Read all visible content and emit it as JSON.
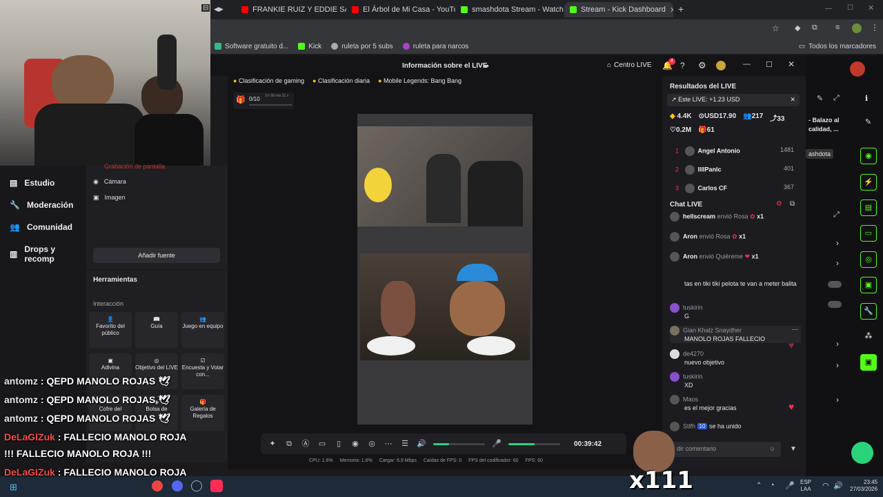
{
  "browser": {
    "tabs": [
      {
        "label": "FRANKIE RUIZ Y EDDIE SANTIA",
        "color": "#ff0000"
      },
      {
        "label": "El Árbol de Mi Casa - YouTube",
        "color": "#ff0000"
      },
      {
        "label": "smashdota Stream - Watch Live",
        "color": "#53fc18"
      },
      {
        "label": "Stream - Kick Dashboard",
        "color": "#53fc18"
      }
    ],
    "new_tab": "+",
    "bookmarks": [
      "Software gratuito d...",
      "Kick",
      "ruleta por 5 subs",
      "ruleta para narcos"
    ],
    "bookmarks_right": "Todos los marcadores"
  },
  "left_nav": {
    "items": [
      {
        "label": "Estudio",
        "icon": "studio-icon"
      },
      {
        "label": "Moderación",
        "icon": "wrench-icon"
      },
      {
        "label": "Comunidad",
        "icon": "users-icon"
      },
      {
        "label": "Drops y recomp",
        "icon": "chart-icon"
      }
    ]
  },
  "sources": {
    "partial": "Grabación de pantalla",
    "items": [
      "Cámara",
      "Imagen"
    ],
    "add_button": "Añadir fuente"
  },
  "tools": {
    "title": "Herramientas",
    "section": "Interacción",
    "tiles": [
      "Favorito del público",
      "Guía",
      "Juego en equipo",
      "Adivina",
      "Objetivo del LIVE",
      "Encuesta y Votar con...",
      "Cofre del",
      "Bolsa de",
      "Galería de Regalos"
    ]
  },
  "studio": {
    "header_title": "Información sobre el LIVE",
    "centro_live": "Centro LIVE",
    "notif_count": "4",
    "chips": [
      "Clasificación de gaming",
      "Clasificación diaria",
      "Mobile Legends: Bang Bang"
    ],
    "goal": "0/10",
    "goal_time": "3 h 58 min 31 s",
    "timer": "00:39:42",
    "stats": [
      {
        "label": "CPU:",
        "value": "1.6%"
      },
      {
        "label": "Memoria:",
        "value": "1.6%"
      },
      {
        "label": "Cargar:",
        "value": "6.9 Mbps"
      },
      {
        "label": "Caídas de FPS:",
        "value": "0"
      },
      {
        "label": "FPS del codificador:",
        "value": "60"
      },
      {
        "label": "FPS:",
        "value": "60"
      }
    ],
    "mic_level": 0.5,
    "audio_level": 0.3
  },
  "live_results": {
    "title": "Resultados del LIVE",
    "earning": "Este LIVE: +1.23 USD",
    "stats": [
      "4.4K",
      "USD17.90",
      "217",
      "33",
      "0.2M",
      "61"
    ],
    "ranking": [
      {
        "rank": "1",
        "name": "Angel Antonio",
        "score": "1481"
      },
      {
        "rank": "2",
        "name": "lllIPanlc",
        "score": "401"
      },
      {
        "rank": "3",
        "name": "Carlos CF",
        "score": "367"
      }
    ]
  },
  "chat": {
    "title": "Chat LIVE",
    "gifts": [
      {
        "user": "hellscream",
        "action": "envió Rosa",
        "count": "x1"
      },
      {
        "user": "Aron",
        "action": "envió Rosa",
        "count": "x1"
      },
      {
        "user": "Aron",
        "action": "envió Quiéreme",
        "count": "x1"
      }
    ],
    "messages": [
      {
        "user": "",
        "text": "tas en tiki tiki pelota te van a meter balita"
      },
      {
        "user": "tuskirin",
        "text": "G"
      },
      {
        "user": "Gian Khalz Snaydher",
        "text": "MANOLO ROJAS FALLECIO"
      },
      {
        "user": "de4270",
        "text": "nuevo objetivo"
      },
      {
        "user": "tuskirin",
        "text": "XD"
      },
      {
        "user": "Maos",
        "text": "es el mejor gracias"
      }
    ],
    "last_user": "Stifh",
    "last_badge": "10",
    "last_text": "se ha unido",
    "input_placeholder": "dir comentario"
  },
  "kick_right": {
    "title_partial": "- Balazo al calidad, ...",
    "chip": "ashdota"
  },
  "overlay": {
    "lines": [
      {
        "user": "antomz",
        "text": ": QEPD MANOLO ROJAS"
      },
      {
        "user": "antomz",
        "text": ": QEPD MANOLO ROJAS"
      },
      {
        "user": "antomz",
        "text": ": QEPD MANOLO ROJAS"
      },
      {
        "user": "DeLaGIZuk",
        "text": ": FALLECIO MANOLO ROJA"
      },
      {
        "user": "",
        "text": "!!! FALLECIO MANOLO ROJA !!!"
      },
      {
        "user": "DeLaGIZuk",
        "text": ": FALLECIO MANOLO ROJA"
      }
    ],
    "combo": "x111"
  },
  "taskbar": {
    "lang": "ESP",
    "lang2": "LAA",
    "time": "23:45",
    "date": "27/03/2026"
  }
}
